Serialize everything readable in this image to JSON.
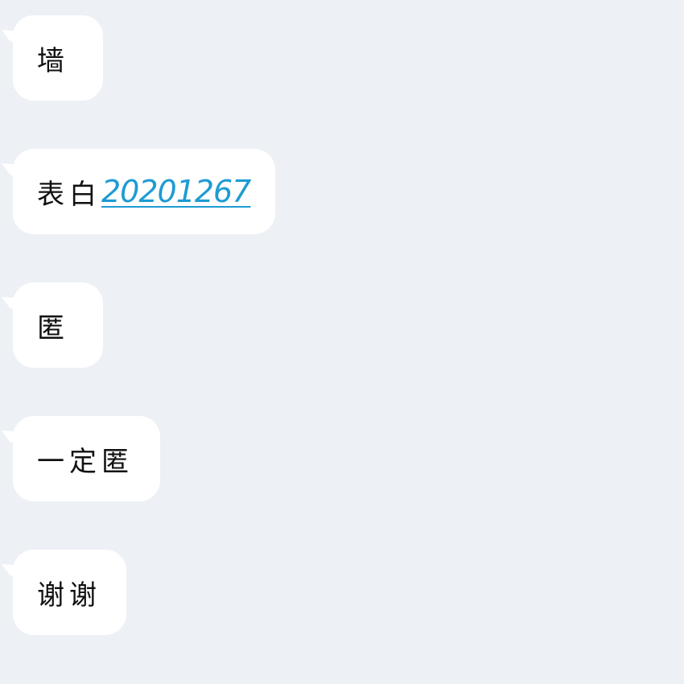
{
  "messages": [
    {
      "text": "墙"
    },
    {
      "text": "表白",
      "link": "20201267"
    },
    {
      "text": "匿"
    },
    {
      "text": "一定匿"
    },
    {
      "text": "谢谢"
    }
  ],
  "colors": {
    "background": "#edf1f6",
    "bubble": "#ffffff",
    "text": "#111111",
    "link": "#1e9bd3"
  }
}
